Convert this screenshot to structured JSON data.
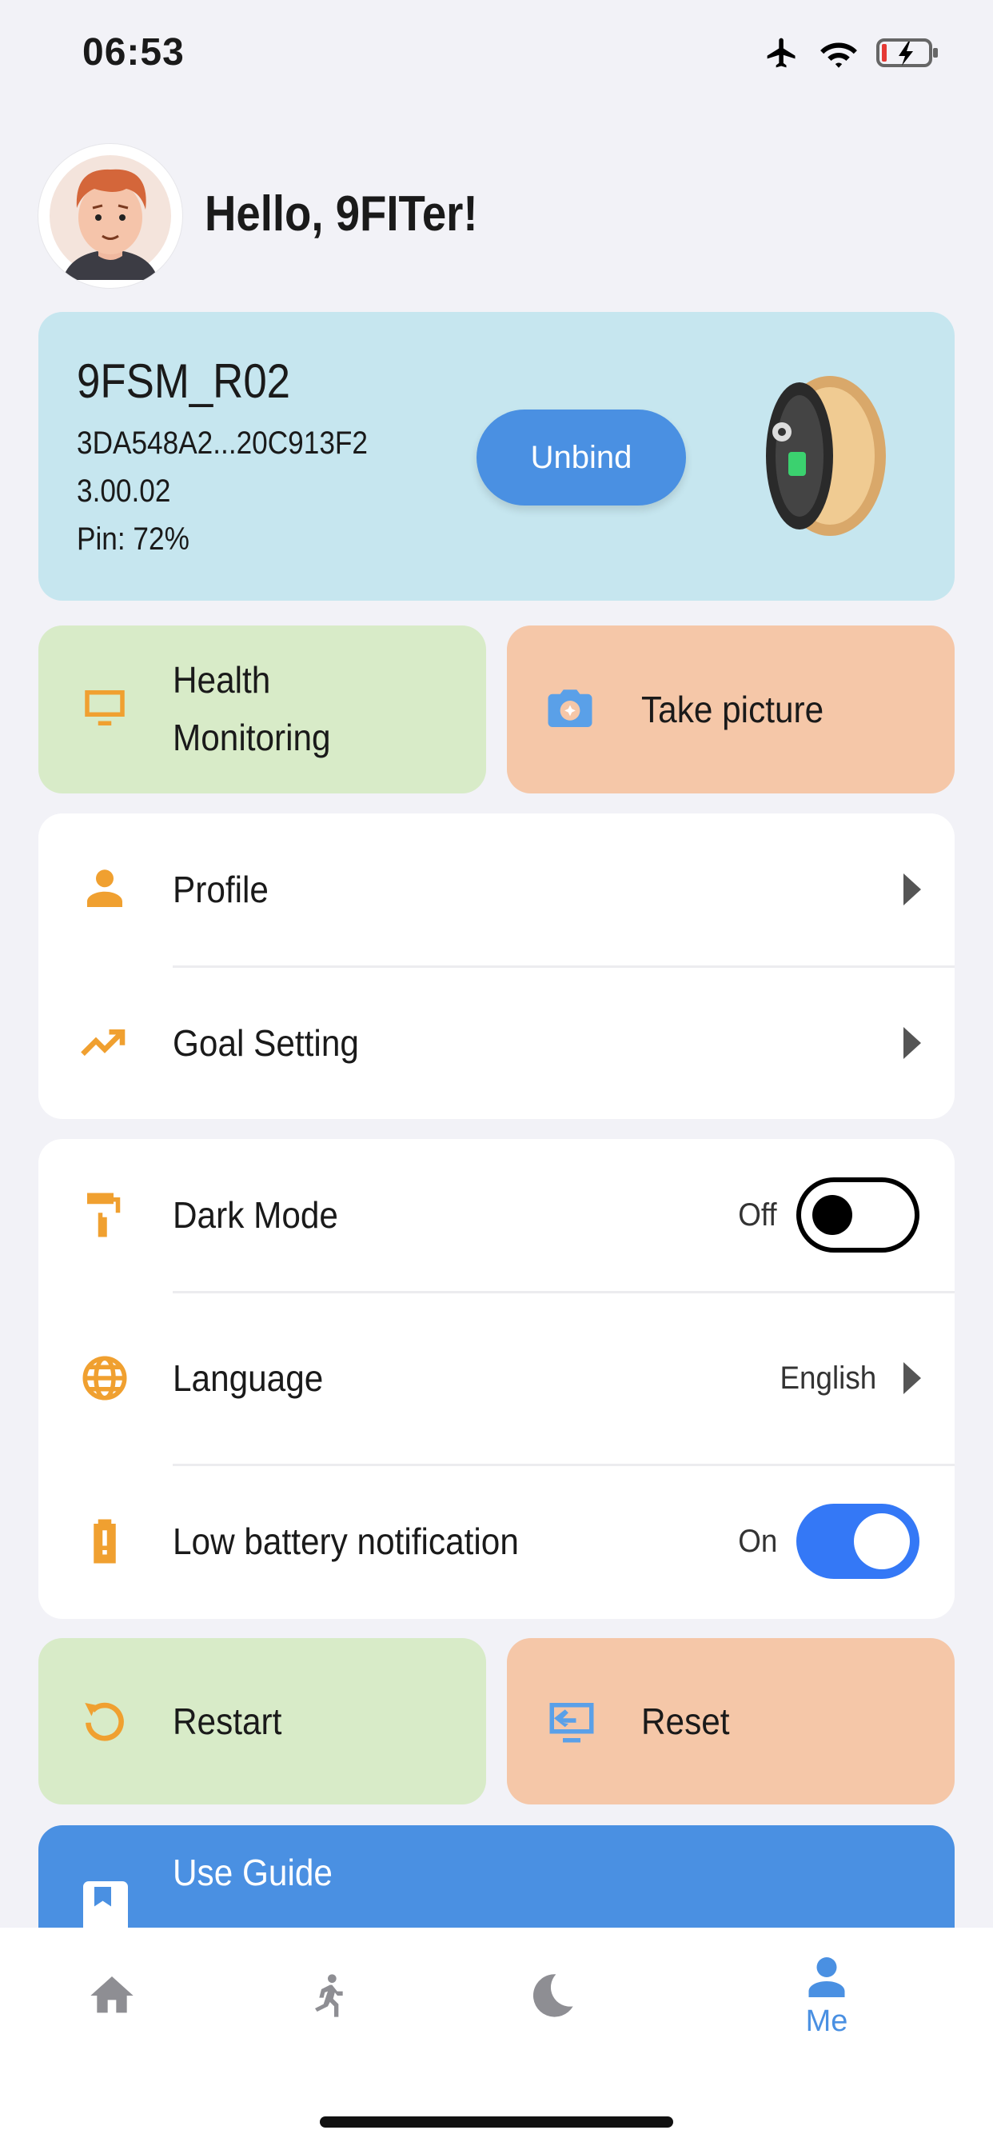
{
  "status_bar": {
    "time": "06:53",
    "icons": [
      "airplane-icon",
      "wifi-icon",
      "battery-charging-icon"
    ]
  },
  "header": {
    "greeting": "Hello, 9FITer!"
  },
  "device": {
    "name": "9FSM_R02",
    "id": "3DA548A2...20C913F2",
    "firmware": "3.00.02",
    "battery": "Pin: 72%",
    "unbind_label": "Unbind"
  },
  "quick_actions": {
    "health_line1": "Health",
    "health_line2": "Monitoring",
    "take_picture": "Take picture"
  },
  "menu": {
    "profile": "Profile",
    "goal_setting": "Goal Setting"
  },
  "settings": {
    "dark_mode": {
      "label": "Dark Mode",
      "value": "Off",
      "on": false
    },
    "language": {
      "label": "Language",
      "value": "English"
    },
    "low_battery": {
      "label": "Low battery notification",
      "value": "On",
      "on": true
    }
  },
  "actions": {
    "restart": "Restart",
    "reset": "Reset"
  },
  "guide": {
    "label": "Use Guide"
  },
  "tabbar": {
    "me_label": "Me",
    "active": "Me"
  },
  "colors": {
    "accent": "#4a90e2",
    "icon_orange": "#f0a030",
    "toggle_on": "#3478f6"
  }
}
